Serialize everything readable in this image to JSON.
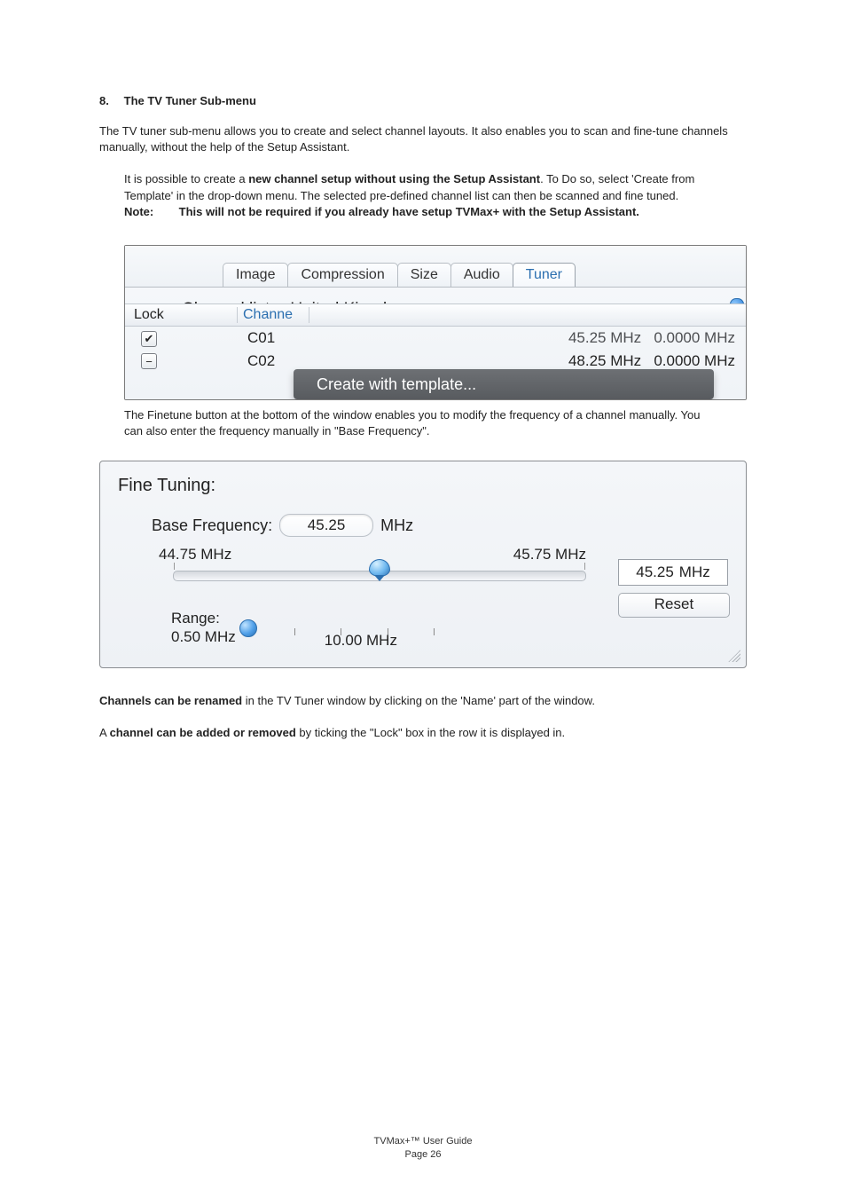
{
  "doc": {
    "heading_num": "8.",
    "heading_title": "The TV Tuner Sub-menu",
    "para1": "The TV tuner sub-menu allows you to create and select channel layouts. It also enables you to scan and fine-tune channels manually, without the help of the Setup Assistant.",
    "para2a": "It is possible to create a ",
    "para2_bold": "new channel setup without using the Setup Assistant",
    "para2b": ". To Do so, select 'Create from Template' in the drop-down menu. The selected pre-defined channel list can then be scanned and  fine tuned.",
    "note_label": "Note:",
    "note_text": "This will not be required if you already have setup TVMax+ with the Setup Assistant.",
    "caption1": "The Finetune button at the bottom of the window enables you to modify the frequency of a channel manually. You can also enter the frequency manually in \"Base Frequency\".",
    "para3_bold": "Channels can be renamed",
    "para3_rest": " in the TV Tuner window by clicking on the 'Name' part of the window.",
    "para4_a": "A ",
    "para4_bold": "channel can be added or removed",
    "para4_rest": " by ticking the \"Lock\" box in the row it is displayed in.",
    "footer_line1": "TVMax+™ User Guide",
    "footer_line2": "Page 26"
  },
  "shot1": {
    "tabs": {
      "image": "Image",
      "compression": "Compression",
      "size": "Size",
      "audio": "Audio",
      "tuner": "Tuner"
    },
    "channel_list_label": "Channel list",
    "selected_country": "United Kingdom",
    "menu_item": "Create with template...",
    "columns": {
      "lock": "Lock",
      "channe": "Channe"
    },
    "rows": [
      {
        "ch": "C01",
        "freq": "45.25 MHz",
        "fine": "0.0000 MHz",
        "locked": true
      },
      {
        "ch": "C02",
        "freq": "48.25 MHz",
        "fine": "0.0000 MHz",
        "locked": false
      }
    ]
  },
  "shot2": {
    "title": "Fine Tuning:",
    "base_label": "Base Frequency:",
    "base_value": "45.25",
    "unit": "MHz",
    "axis_min": "44.75 MHz",
    "axis_max": "45.75 MHz",
    "readout_value": "45.25",
    "reset_label": "Reset",
    "range_label": "Range:",
    "range_min": "0.50 MHz",
    "range_max": "10.00 MHz"
  }
}
